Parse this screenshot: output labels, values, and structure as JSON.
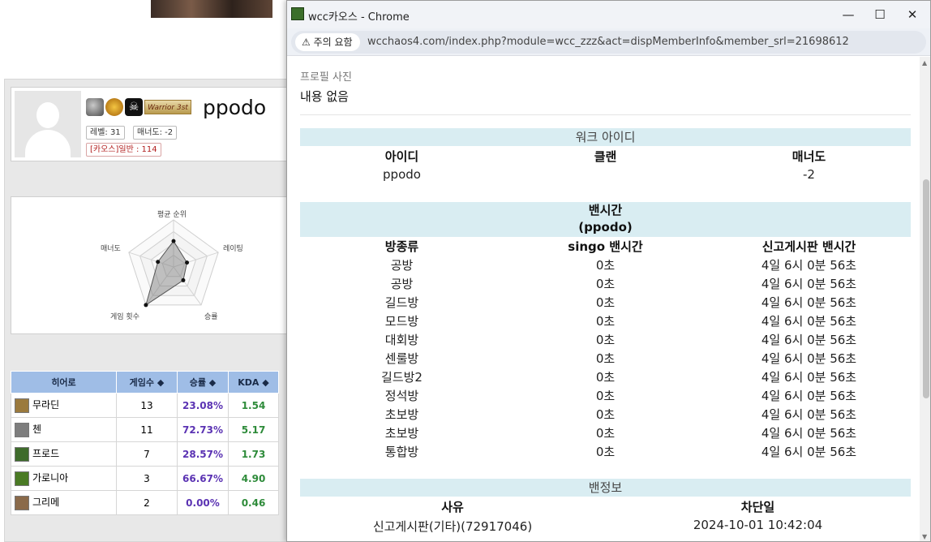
{
  "profile": {
    "nickname": "ppodo",
    "level": "레벨: 31",
    "manner": "매너도: -2",
    "rank": "[카오스]일반 : 114",
    "warrior_badge": "Warrior 3st"
  },
  "radar": {
    "labels": [
      "평균 순위",
      "레이팅",
      "승률",
      "게임 횟수",
      "매너도"
    ],
    "values": [
      0.55,
      0.3,
      0.35,
      1.0,
      0.35
    ]
  },
  "hero_table": {
    "headers": [
      "히어로",
      "게임수 ◆",
      "승률 ◆",
      "KDA ◆"
    ],
    "rows": [
      {
        "hero": "무라딘",
        "games": "13",
        "winrate": "23.08%",
        "kda": "1.54",
        "color": "#9b7a3d"
      },
      {
        "hero": "첸",
        "games": "11",
        "winrate": "72.73%",
        "kda": "5.17",
        "color": "#7d7d7d"
      },
      {
        "hero": "프로드",
        "games": "7",
        "winrate": "28.57%",
        "kda": "1.73",
        "color": "#3e6b2b"
      },
      {
        "hero": "가로니아",
        "games": "3",
        "winrate": "66.67%",
        "kda": "4.90",
        "color": "#4a7a24"
      },
      {
        "hero": "그리메",
        "games": "2",
        "winrate": "0.00%",
        "kda": "0.46",
        "color": "#8a6a4a"
      }
    ]
  },
  "window": {
    "title": "wcc카오스 - Chrome",
    "warning": "⚠ 주의 요함",
    "url": "wcchaos4.com/index.php?module=wcc_zzz&act=dispMemberInfo&member_srl=21698612",
    "minimize": "—",
    "maximize": "☐",
    "close": "✕"
  },
  "member_info": {
    "profile_photo_label": "프로필 사진",
    "profile_photo_value": "내용 없음",
    "wc_header": "워크 아이디",
    "wc_columns": [
      "아이디",
      "클랜",
      "매너도"
    ],
    "wc_values": [
      "ppodo",
      "",
      "-2"
    ],
    "ban_time_header": "밴시간",
    "ban_time_sub": "(ppodo)",
    "ban_columns": [
      "방종류",
      "singo 밴시간",
      "신고게시판 밴시간"
    ],
    "ban_rows": [
      [
        "공방",
        "0초",
        "4일 6시 0분 56초"
      ],
      [
        "공방",
        "0초",
        "4일 6시 0분 56초"
      ],
      [
        "길드방",
        "0초",
        "4일 6시 0분 56초"
      ],
      [
        "모드방",
        "0초",
        "4일 6시 0분 56초"
      ],
      [
        "대회방",
        "0초",
        "4일 6시 0분 56초"
      ],
      [
        "센룰방",
        "0초",
        "4일 6시 0분 56초"
      ],
      [
        "길드방2",
        "0초",
        "4일 6시 0분 56초"
      ],
      [
        "정석방",
        "0초",
        "4일 6시 0분 56초"
      ],
      [
        "초보방",
        "0초",
        "4일 6시 0분 56초"
      ],
      [
        "초보방",
        "0초",
        "4일 6시 0분 56초"
      ],
      [
        "통합방",
        "0초",
        "4일 6시 0분 56초"
      ]
    ],
    "ban_info_header": "밴정보",
    "ban_info_columns": [
      "사유",
      "차단일"
    ],
    "ban_info_values": [
      "신고게시판(기타)(72917046)",
      "2024-10-01 10:42:04"
    ]
  }
}
